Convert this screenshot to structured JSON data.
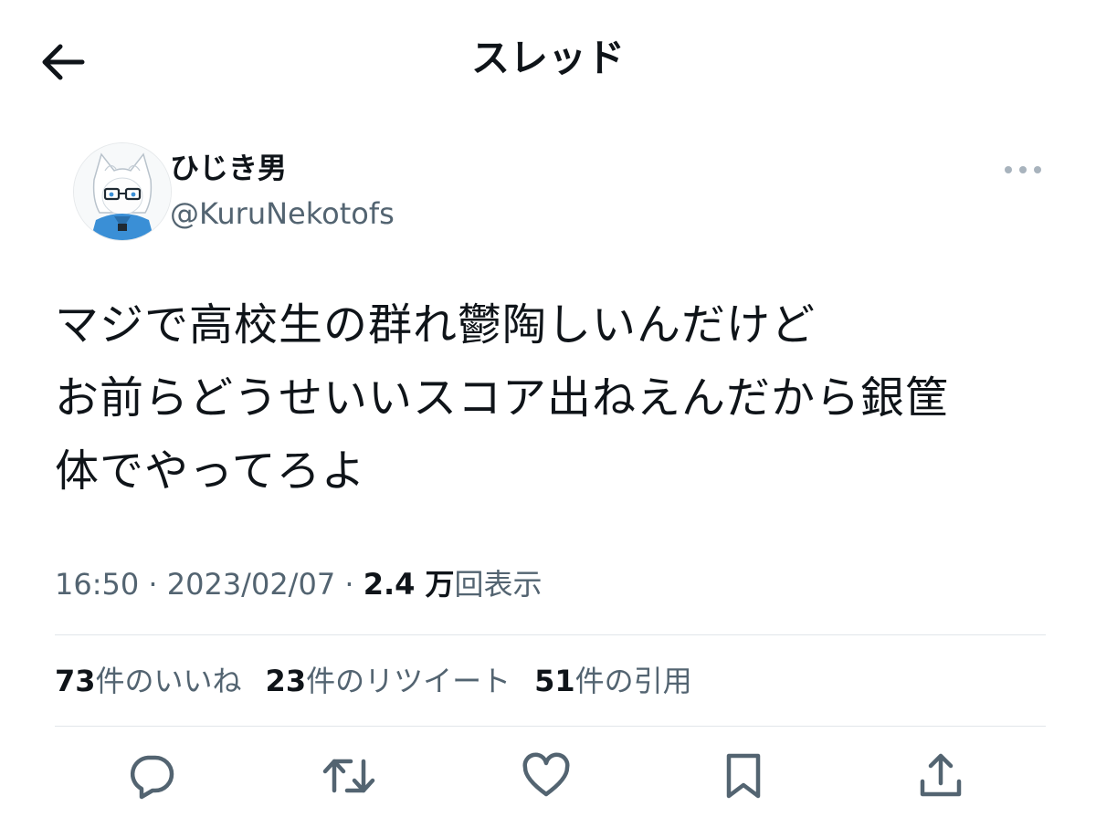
{
  "header": {
    "title": "スレッド",
    "back_icon": "arrow-left-icon"
  },
  "tweet": {
    "author": {
      "display_name": "ひじき男",
      "handle": "@KuruNekotofs",
      "avatar_icon": "cat-ear-character-avatar"
    },
    "more_icon": "more-horizontal-icon",
    "text_lines": [
      "マジで高校生の群れ鬱陶しいんだけど",
      "お前らどうせいいスコア出ねえんだから銀筐",
      "体でやってろよ"
    ],
    "time": "16:50",
    "date": "2023/02/07",
    "separator": "·",
    "views_count": "2.4 万",
    "views_label": "回表示"
  },
  "stats": {
    "likes_count": "73",
    "likes_label": "件のいいね",
    "retweets_count": "23",
    "retweets_label": "件のリツイート",
    "quotes_count": "51",
    "quotes_label": "件の引用"
  },
  "actions": [
    {
      "icon": "reply-icon"
    },
    {
      "icon": "retweet-icon"
    },
    {
      "icon": "heart-icon"
    },
    {
      "icon": "bookmark-icon"
    },
    {
      "icon": "share-icon"
    }
  ],
  "colors": {
    "text_primary": "#0f1419",
    "text_secondary": "#536471",
    "divider": "#e1e6ea",
    "avatar_accent": "#3a8fd6"
  }
}
